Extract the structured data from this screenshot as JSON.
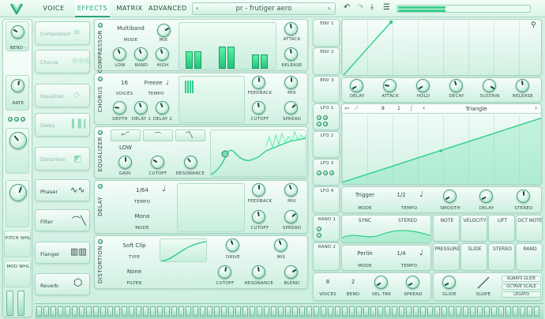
{
  "tabs": [
    "VOICE",
    "EFFECTS",
    "MATRIX",
    "ADVANCED"
  ],
  "active_tab": "EFFECTS",
  "preset_name": "pr - frutiger aero",
  "left_strip": {
    "bend": "BEND -",
    "rate": "RATE",
    "pitch_whl": "PITCH WHL",
    "mod_whl": "MOD WHL"
  },
  "fx_list": [
    "Compressor",
    "Chorus",
    "Equalizer",
    "Delay",
    "Distortion",
    "Phaser",
    "Filter",
    "Flanger",
    "Reverb"
  ],
  "compressor": {
    "title": "COMPRESSOR",
    "mode_value": "Multiband",
    "mode": "MODE",
    "mix": "MIX",
    "low": "LOW",
    "band": "BAND",
    "high": "HIGH",
    "attack": "ATTACK",
    "release": "RELEASE"
  },
  "chorus": {
    "title": "CHORUS",
    "voices_value": "16",
    "voices": "VOICES",
    "tempo_value": "Freeze",
    "tempo": "TEMPO",
    "depth": "DEPTH",
    "delay1": "DELAY 1",
    "delay2": "DELAY 2",
    "feedback": "FEEDBACK",
    "mix": "MIX",
    "cutoff": "CUTOFF",
    "spread": "SPREAD"
  },
  "equalizer": {
    "title": "EQUALIZER",
    "low": "LOW",
    "gain": "GAIN",
    "cutoff": "CUTOFF",
    "resonance": "RESONANCE"
  },
  "delay": {
    "title": "DELAY",
    "tempo_value": "1/64",
    "tempo": "TEMPO",
    "mode_value": "Mono",
    "mode": "MODE",
    "feedback": "FEEDBACK",
    "mix": "MIX",
    "cutoff": "CUTOFF",
    "spread": "SPREAD"
  },
  "distortion": {
    "title": "DISTORTION",
    "type_value": "Soft Clip",
    "type": "TYPE",
    "filter_value": "None",
    "filter": "FILTER",
    "drive": "DRIVE",
    "mix": "MIX",
    "cutoff": "CUTOFF",
    "resonance": "RESONANCE",
    "blend": "BLEND"
  },
  "env_tabs": [
    "ENV 1",
    "ENV 2",
    "ENV 3"
  ],
  "env_knobs": [
    "DELAY",
    "ATTACK",
    "HOLD",
    "DECAY",
    "SUSTAIN",
    "RELEASE"
  ],
  "lfo_tabs": [
    "LFO 1",
    "LFO 2",
    "LFO 3",
    "LFO 4"
  ],
  "lfo": {
    "shape": "Triangle",
    "div1": "8",
    "div2": "1",
    "mode_value": "Trigger",
    "mode": "MODE",
    "tempo_value": "1/2",
    "tempo": "TEMPO",
    "smooth": "SMOOTH",
    "delay": "DELAY",
    "stereo": "STEREO"
  },
  "rand_tabs": [
    "RAND 1",
    "RAND 2"
  ],
  "rand": {
    "sync": "SYNC",
    "stereo": "STEREO",
    "mode_value": "Perlin",
    "mode": "MODE",
    "tempo_value": "1/4",
    "tempo": "TEMPO"
  },
  "mod_sources": [
    "NOTE",
    "VELOCITY",
    "LIFT",
    "OCT NOTE",
    "PRESSURE",
    "SLIDE",
    "STEREO",
    "RAND"
  ],
  "voice": {
    "voices_value": "8",
    "voices": "VOICES",
    "bend_value": "2",
    "bend": "BEND",
    "veltrk": "VEL TRK",
    "spread": "SPREAD",
    "glide": "GLIDE",
    "slope": "SLOPE"
  },
  "toggles": [
    "ALWAYS GLIDE",
    "OCTAVE SCALE",
    "LEGATO"
  ]
}
